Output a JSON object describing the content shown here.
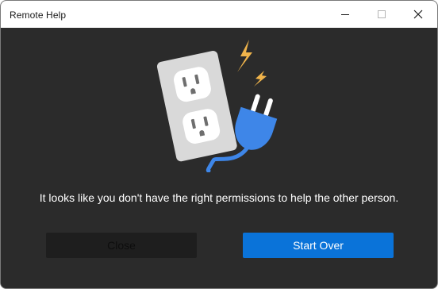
{
  "window": {
    "title": "Remote Help"
  },
  "message": "It looks like you don't have the right permissions to help the other person.",
  "buttons": {
    "close_label": "Close",
    "start_over_label": "Start Over"
  },
  "colors": {
    "background": "#2b2b2b",
    "primary": "#0a73d9",
    "secondary": "#1e1e1e",
    "plug": "#3e86e8",
    "outlet": "#d9d9d9",
    "spark": "#f0b44b"
  },
  "icons": {
    "minimize": "minimize-icon",
    "maximize": "maximize-icon",
    "close": "close-icon",
    "illustration": "unplugged-outlet-illustration"
  }
}
